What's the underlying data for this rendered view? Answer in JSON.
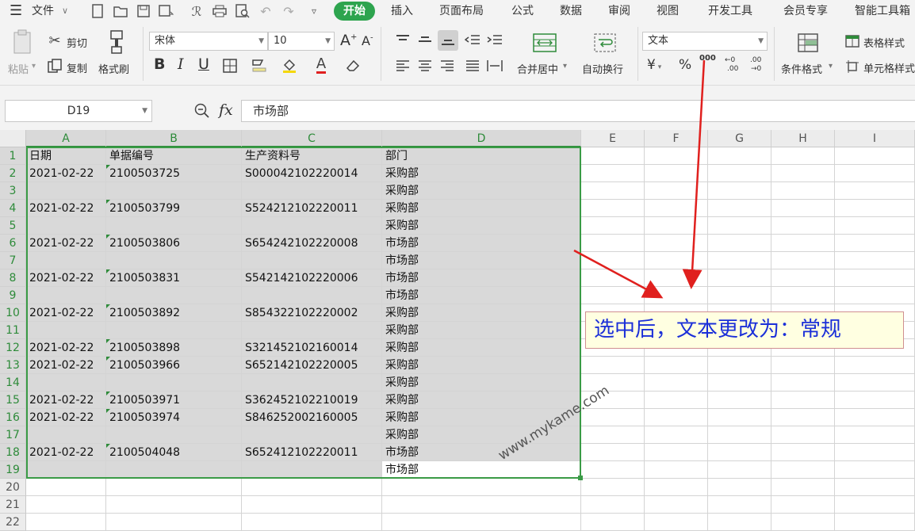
{
  "menu": {
    "file_label": "文件",
    "tabs": [
      "开始",
      "插入",
      "页面布局",
      "公式",
      "数据",
      "审阅",
      "视图",
      "开发工具",
      "会员专享",
      "智能工具箱"
    ]
  },
  "ribbon": {
    "paste": "粘贴",
    "cut": "剪切",
    "copy": "复制",
    "format_painter": "格式刷",
    "font_name": "宋体",
    "font_size": "10",
    "merge_center": "合并居中",
    "wrap_text": "自动换行",
    "number_format": "文本",
    "currency_symbol": "¥",
    "percent_symbol": "%",
    "thousands_symbol": "000",
    "conditional_format": "条件格式",
    "table_style": "表格样式",
    "cell_style": "单元格样式"
  },
  "formula_bar": {
    "name_box": "D19",
    "fx": "fx",
    "value": "市场部"
  },
  "sheet": {
    "columns": [
      "A",
      "B",
      "C",
      "D",
      "E",
      "F",
      "G",
      "H",
      "I"
    ],
    "row_numbers": [
      "1",
      "2",
      "3",
      "4",
      "5",
      "6",
      "7",
      "8",
      "9",
      "10",
      "11",
      "12",
      "13",
      "14",
      "15",
      "16",
      "17",
      "18",
      "19",
      "20",
      "21",
      "22"
    ],
    "rows": [
      [
        "日期",
        "单据编号",
        "生产资料号",
        "部门"
      ],
      [
        "2021-02-22",
        "2100503725",
        "S000042102220014",
        "采购部"
      ],
      [
        "",
        "",
        "",
        "采购部"
      ],
      [
        "2021-02-22",
        "2100503799",
        "S524212102220011",
        "采购部"
      ],
      [
        "",
        "",
        "",
        "采购部"
      ],
      [
        "2021-02-22",
        "2100503806",
        "S654242102220008",
        "市场部"
      ],
      [
        "",
        "",
        "",
        "市场部"
      ],
      [
        "2021-02-22",
        "2100503831",
        "S542142102220006",
        "市场部"
      ],
      [
        "",
        "",
        "",
        "市场部"
      ],
      [
        "2021-02-22",
        "2100503892",
        "S854322102220002",
        "采购部"
      ],
      [
        "",
        "",
        "",
        "采购部"
      ],
      [
        "2021-02-22",
        "2100503898",
        "S321452102160014",
        "采购部"
      ],
      [
        "2021-02-22",
        "2100503966",
        "S652142102220005",
        "采购部"
      ],
      [
        "",
        "",
        "",
        "采购部"
      ],
      [
        "2021-02-22",
        "2100503971",
        "S362452102210019",
        "采购部"
      ],
      [
        "2021-02-22",
        "2100503974",
        "S846252002160005",
        "采购部"
      ],
      [
        "",
        "",
        "",
        "采购部"
      ],
      [
        "2021-02-22",
        "2100504048",
        "S652412102220011",
        "市场部"
      ],
      [
        "",
        "",
        "",
        "市场部"
      ]
    ]
  },
  "annotation": {
    "text": "选中后，文本更改为：常规",
    "watermark": "www.mykame.com"
  },
  "colors": {
    "accent_green": "#2da44e",
    "selection_border": "#3a9b46",
    "arrow_red": "#e0201e",
    "note_text": "#1b2fd8"
  }
}
